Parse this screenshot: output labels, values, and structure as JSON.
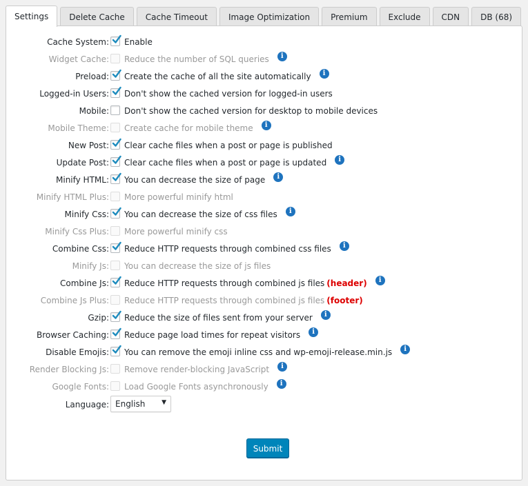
{
  "tabs": [
    "Settings",
    "Delete Cache",
    "Cache Timeout",
    "Image Optimization",
    "Premium",
    "Exclude",
    "CDN",
    "DB (68)"
  ],
  "rows": [
    {
      "label": "Cache System:",
      "text": "Enable",
      "checked": true,
      "disabled": false,
      "info": false
    },
    {
      "label": "Widget Cache:",
      "text": "Reduce the number of SQL queries",
      "checked": false,
      "disabled": true,
      "info": true
    },
    {
      "label": "Preload:",
      "text": "Create the cache of all the site automatically",
      "checked": true,
      "disabled": false,
      "info": true
    },
    {
      "label": "Logged-in Users:",
      "text": "Don't show the cached version for logged-in users",
      "checked": true,
      "disabled": false,
      "info": false
    },
    {
      "label": "Mobile:",
      "text": "Don't show the cached version for desktop to mobile devices",
      "checked": false,
      "disabled": false,
      "info": false
    },
    {
      "label": "Mobile Theme:",
      "text": "Create cache for mobile theme",
      "checked": false,
      "disabled": true,
      "info": true
    },
    {
      "label": "New Post:",
      "text": "Clear cache files when a post or page is published",
      "checked": true,
      "disabled": false,
      "info": false
    },
    {
      "label": "Update Post:",
      "text": "Clear cache files when a post or page is updated",
      "checked": true,
      "disabled": false,
      "info": true
    },
    {
      "label": "Minify HTML:",
      "text": "You can decrease the size of page",
      "checked": true,
      "disabled": false,
      "info": true
    },
    {
      "label": "Minify HTML Plus:",
      "text": "More powerful minify html",
      "checked": false,
      "disabled": true,
      "info": false
    },
    {
      "label": "Minify Css:",
      "text": "You can decrease the size of css files",
      "checked": true,
      "disabled": false,
      "info": true
    },
    {
      "label": "Minify Css Plus:",
      "text": "More powerful minify css",
      "checked": false,
      "disabled": true,
      "info": false
    },
    {
      "label": "Combine Css:",
      "text": "Reduce HTTP requests through combined css files",
      "checked": true,
      "disabled": false,
      "info": true
    },
    {
      "label": "Minify Js:",
      "text": "You can decrease the size of js files",
      "checked": false,
      "disabled": true,
      "info": false
    },
    {
      "label": "Combine Js:",
      "text": "Reduce HTTP requests through combined js files",
      "tag": "(header)",
      "checked": true,
      "disabled": false,
      "info": true
    },
    {
      "label": "Combine Js Plus:",
      "text": "Reduce HTTP requests through combined js files",
      "tag": "(footer)",
      "checked": false,
      "disabled": true,
      "info": false
    },
    {
      "label": "Gzip:",
      "text": "Reduce the size of files sent from your server",
      "checked": true,
      "disabled": false,
      "info": true
    },
    {
      "label": "Browser Caching:",
      "text": "Reduce page load times for repeat visitors",
      "checked": true,
      "disabled": false,
      "info": true
    },
    {
      "label": "Disable Emojis:",
      "text": "You can remove the emoji inline css and wp-emoji-release.min.js",
      "checked": true,
      "disabled": false,
      "info": true
    },
    {
      "label": "Render Blocking Js:",
      "text": "Remove render-blocking JavaScript",
      "checked": false,
      "disabled": true,
      "info": true
    },
    {
      "label": "Google Fonts:",
      "text": "Load Google Fonts asynchronously",
      "checked": false,
      "disabled": true,
      "info": true
    }
  ],
  "language": {
    "label": "Language:",
    "value": "English"
  },
  "submit_label": "Submit",
  "colors": {
    "accent": "#0085ba",
    "info": "#1e73be",
    "check": "#1e8cbe",
    "tag": "#dd0000"
  }
}
